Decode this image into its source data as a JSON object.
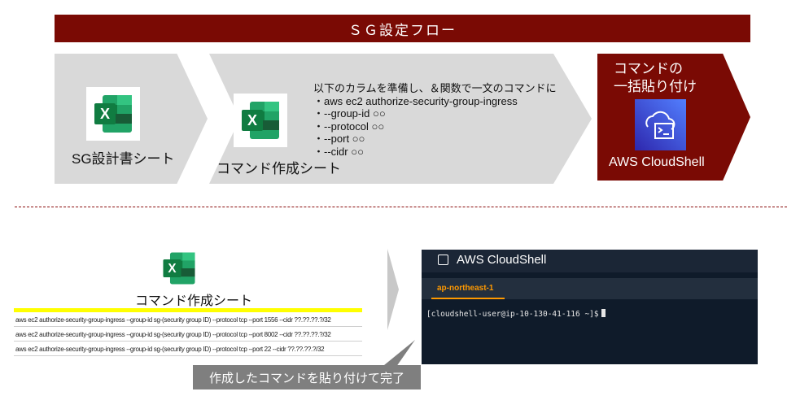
{
  "title": "ＳＧ設定フロー",
  "step1": {
    "label": "SG設計書シート",
    "icon": "excel-icon"
  },
  "step2": {
    "label": "コマンド作成シート",
    "icon": "excel-icon",
    "instructions": [
      "以下のカラムを準備し、＆関数で一文のコマンドに",
      "・aws ec2 authorize-security-group-ingress",
      "・--group-id ○○",
      "・--protocol ○○",
      "・--port ○○",
      "・--cidr ○○"
    ]
  },
  "step3": {
    "title_line1": "コマンドの",
    "title_line2": "一括貼り付け",
    "label": "AWS CloudShell",
    "icon": "cloudshell-icon"
  },
  "bottom": {
    "sheet_label": "コマンド作成シート",
    "rows": [
      "aws ec2 authorize-security-group-ingress --group-id sg-(security group ID) --protocol tcp --port 1556 --cidr ??.??.??.?/32",
      "aws ec2 authorize-security-group-ingress --group-id sg-(security group ID) --protocol tcp --port 8002 --cidr ??.??.??.?/32",
      "aws ec2 authorize-security-group-ingress --group-id sg-(security group ID) --protocol tcp --port 22 --cidr ??.??.??.?/32"
    ],
    "terminal": {
      "title": "AWS CloudShell",
      "tab": "ap-northeast-1",
      "prompt": "[cloudshell-user@ip-10-130-41-116 ~]$"
    },
    "callout": "作成したコマンドを貼り付けて完了"
  },
  "colors": {
    "accent": "#7a0a04",
    "chevron_gray": "#d9d9d9",
    "excel_green": "#107c41",
    "cloudshell_blue": "#3b48cc",
    "terminal_bg": "#0f1b2a",
    "tab_orange": "#ff9900",
    "highlight_yellow": "#ffff00"
  }
}
